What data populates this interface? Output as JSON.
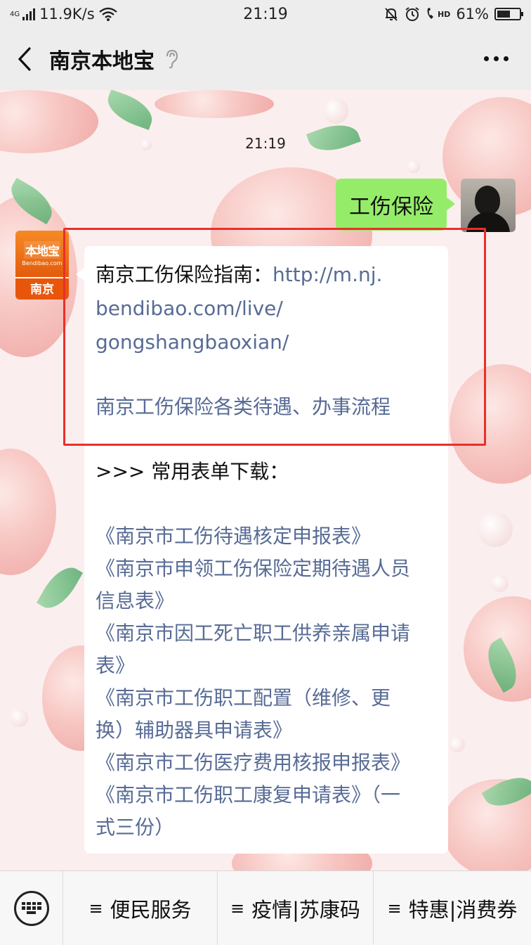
{
  "status_bar": {
    "network_tag": "4G",
    "speed": "11.9K/s",
    "time": "21:19",
    "hd_tag": "HD",
    "battery_percent": "61%",
    "battery_level": 0.61,
    "icons": [
      "signal-icon",
      "wifi-icon",
      "mute-bell-icon",
      "alarm-icon",
      "hd-call-icon",
      "battery-icon"
    ]
  },
  "nav": {
    "title": "南京本地宝",
    "back_icon": "chevron-left-icon",
    "ear_icon": "ear-icon",
    "more_icon": "more-dots-icon"
  },
  "chat": {
    "timestamp": "21:19",
    "user_message": "工伤保险",
    "bot_avatar": {
      "logo_text": "本地宝",
      "logo_sub": "Bendibao.com",
      "city": "南京"
    },
    "reply": {
      "guide_label": "南京工伤保险指南：",
      "guide_link_1": "http://m.nj.",
      "guide_link_2": "bendibao.com/live/",
      "guide_link_3": "gongshangbaoxian/",
      "treatment_link": "南京工伤保险各类待遇、办事流程",
      "forms_header": ">>> 常用表单下载：",
      "forms": [
        [
          "《南京市工伤待遇核定申报表》"
        ],
        [
          "《南京市申领工伤保险定期待遇人员",
          "信息表》"
        ],
        [
          "《南京市因工死亡职工供养亲属申请",
          "表》"
        ],
        [
          "《南京市工伤职工配置（维修、更",
          "换）辅助器具申请表》"
        ],
        [
          "《南京市工伤医疗费用核报申报表》"
        ],
        [
          "《南京市工伤职工康复申请表》（一",
          "式三份）"
        ]
      ]
    },
    "highlight_color": "#e8302a"
  },
  "bottom_menu": {
    "keyboard_icon": "keyboard-icon",
    "items": [
      {
        "glyph": "≡",
        "label": "便民服务"
      },
      {
        "glyph": "≡",
        "label": "疫情|苏康码"
      },
      {
        "glyph": "≡",
        "label": "特惠|消费券"
      }
    ]
  },
  "colors": {
    "user_bubble": "#95ec69",
    "link": "#576b95",
    "brand_orange": "#e8560c"
  }
}
